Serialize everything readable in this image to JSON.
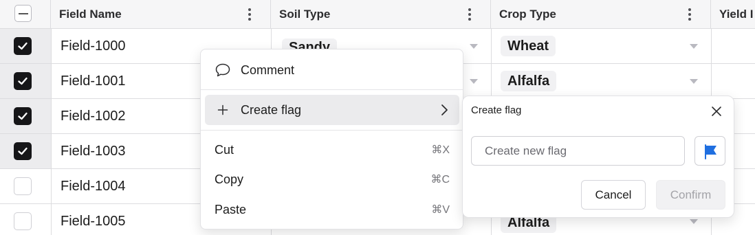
{
  "header": {
    "columns": [
      {
        "label": "Field Name"
      },
      {
        "label": "Soil Type"
      },
      {
        "label": "Crop Type"
      },
      {
        "label": "Yield I"
      }
    ]
  },
  "rows": [
    {
      "field": "Field-1000",
      "soil": "Sandy",
      "crop": "Wheat",
      "selected": true
    },
    {
      "field": "Field-1001",
      "soil": "",
      "crop": "Alfalfa",
      "selected": true
    },
    {
      "field": "Field-1002",
      "soil": "",
      "crop": "",
      "selected": true
    },
    {
      "field": "Field-1003",
      "soil": "",
      "crop": "",
      "selected": true
    },
    {
      "field": "Field-1004",
      "soil": "",
      "crop": "",
      "selected": false
    },
    {
      "field": "Field-1005",
      "soil": "",
      "crop": "Alfalfa",
      "selected": false
    }
  ],
  "context_menu": {
    "comment": "Comment",
    "create_flag": "Create flag",
    "cut": "Cut",
    "cut_shortcut": "⌘X",
    "copy": "Copy",
    "copy_shortcut": "⌘C",
    "paste": "Paste",
    "paste_shortcut": "⌘V"
  },
  "flag_popover": {
    "title": "Create flag",
    "input_placeholder": "Create new flag",
    "input_value": "",
    "cancel": "Cancel",
    "confirm": "Confirm",
    "flag_color": "#1f6fe0"
  },
  "colors": {
    "checkbox_checked": "#161618",
    "accent_flag": "#1f6fe0"
  }
}
